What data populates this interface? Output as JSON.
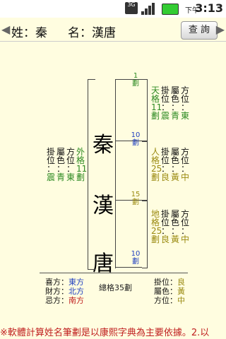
{
  "statusbar": {
    "net": "3G",
    "time_label": "下午",
    "time": "3:13"
  },
  "header": {
    "surname_label": "姓：秦",
    "given_label": "名：漢唐",
    "query_button": "查 詢"
  },
  "chars": [
    "秦",
    "漢",
    "唐"
  ],
  "strokes": {
    "top": [
      "1",
      "劃"
    ],
    "s1": [
      "10",
      "劃"
    ],
    "s2": [
      "15",
      "劃"
    ],
    "s3": [
      "10",
      "劃"
    ]
  },
  "sky": {
    "c1": [
      "天",
      "格",
      "11",
      "劃"
    ],
    "c2": [
      "掛",
      "位",
      "：",
      "震"
    ],
    "c3": [
      "屬",
      "色",
      "：",
      "青"
    ],
    "c4": [
      "方",
      "位",
      "：",
      "東"
    ]
  },
  "person": {
    "c1": [
      "人",
      "格",
      "25",
      "劃"
    ],
    "c2": [
      "掛",
      "位",
      "：",
      "良"
    ],
    "c3": [
      "屬",
      "色",
      "：",
      "黃"
    ],
    "c4": [
      "方",
      "位",
      "：",
      "中"
    ]
  },
  "earth": {
    "c1": [
      "地",
      "格",
      "25",
      "劃"
    ],
    "c2": [
      "掛",
      "位",
      "：",
      "良"
    ],
    "c3": [
      "屬",
      "色",
      "：",
      "黃"
    ],
    "c4": [
      "方",
      "位",
      "：",
      "中"
    ]
  },
  "outer": {
    "c1": [
      "掛",
      "位",
      "：",
      "震"
    ],
    "c2": [
      "屬",
      "色",
      "：",
      "青"
    ],
    "c3": [
      "方",
      "位",
      "：",
      "東"
    ],
    "c4": [
      "外",
      "格",
      "11",
      "劃"
    ]
  },
  "bottom_left": [
    {
      "label": "喜方：",
      "value": "東方"
    },
    {
      "label": "財方：",
      "value": "北方"
    },
    {
      "label": "忌方：",
      "value": "南方"
    }
  ],
  "total": "總格35劃",
  "bottom_right": [
    {
      "label": "掛位：",
      "value": "良"
    },
    {
      "label": "屬色：",
      "value": "黃"
    },
    {
      "label": "方位：",
      "value": "中"
    }
  ],
  "footer": "※軟體計算姓名筆劃是以康熙字典為主要依據。2.以"
}
